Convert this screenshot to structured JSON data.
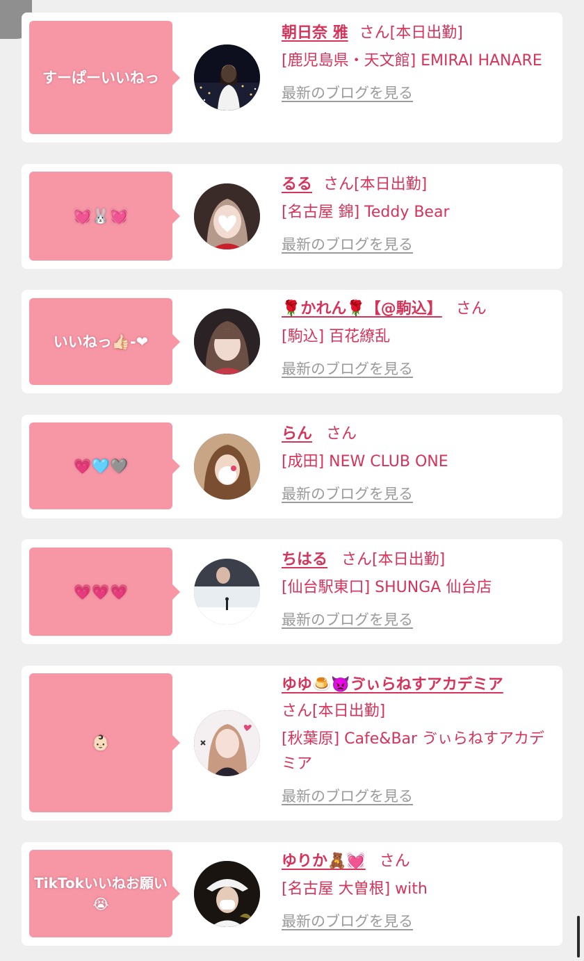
{
  "blog_link_label": "最新のブログを見る",
  "colors": {
    "page_bg": "#efefef",
    "card_bg": "#ffffff",
    "bubble": "#f797a6",
    "accent": "#d6335a",
    "link_gray": "#9a9a9a"
  },
  "cards": [
    {
      "message": "すーぱーいいねっ",
      "name": "朝日奈 雅",
      "suffix": "さん[本日出勤]",
      "shop": "[鹿児島県・天文館] EMIRAI HANARE",
      "avatar_icon": "night-cityscape-photo"
    },
    {
      "message": "💓🐰💓",
      "name": "るる",
      "suffix": "さん[本日出勤]",
      "shop": "[名古屋 錦] Teddy Bear",
      "avatar_icon": "heart-masked-face-photo"
    },
    {
      "message": "いいねっ👍🏻-❤",
      "name": "🌹かれん🌹【@駒込】",
      "suffix": "さん",
      "shop": "[駒込] 百花繚乱",
      "avatar_icon": "portrait-photo"
    },
    {
      "message": "💗🩵🩶",
      "name": "らん",
      "suffix": "さん",
      "shop": "[成田] NEW CLUB ONE",
      "avatar_icon": "sticker-masked-face-photo"
    },
    {
      "message": "💗💗💗",
      "name": "ちはる",
      "suffix": "さん[本日出勤]",
      "shop": "[仙台駅東口] SHUNGA 仙台店",
      "avatar_icon": "snow-scene-photo"
    },
    {
      "message": "👶🏻",
      "name": "ゆゆ🍮👿ゔぃらねすアカデミア",
      "suffix": "さん[本日出勤]",
      "shop": "[秋葉原] Cafe&Bar ゔぃらねすアカデミア",
      "avatar_icon": "idol-portrait-photo"
    },
    {
      "message": "TikTokいいねお願い😭",
      "name": "ゆりか🧸💓",
      "suffix": "さん",
      "shop": "[名古屋 大曽根] with",
      "avatar_icon": "masked-portrait-photo"
    }
  ]
}
